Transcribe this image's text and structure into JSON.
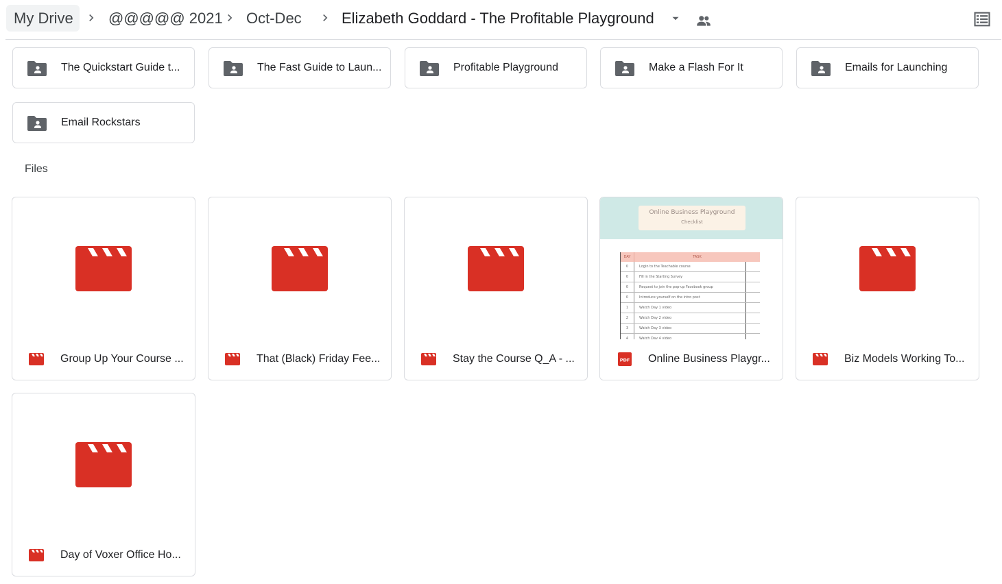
{
  "breadcrumb": {
    "items": [
      "My Drive",
      "@@@@@ 2021",
      "Oct-Dec",
      "Elizabeth Goddard - The Profitable Playground"
    ],
    "separator_icon": "chevron-right-icon",
    "dropdown_icon": "arrow-drop-down-icon",
    "shared_icon": "people-icon"
  },
  "toolbar": {
    "view_icon": "list-view-icon"
  },
  "folders": [
    {
      "label": "The Quickstart Guide t..."
    },
    {
      "label": "The Fast Guide to Laun..."
    },
    {
      "label": "Profitable Playground"
    },
    {
      "label": "Make a Flash For It"
    },
    {
      "label": "Emails for Launching"
    },
    {
      "label": "Email Rockstars"
    }
  ],
  "files_section": {
    "label": "Files"
  },
  "files": [
    {
      "name": "Group Up Your Course ...",
      "type": "video"
    },
    {
      "name": "That (Black) Friday Fee...",
      "type": "video"
    },
    {
      "name": "Stay the Course Q_A - ...",
      "type": "video"
    },
    {
      "name": "Online Business Playgr...",
      "type": "pdf"
    },
    {
      "name": "Biz Models Working To...",
      "type": "video"
    },
    {
      "name": "Day of Voxer Office Ho...",
      "type": "video"
    }
  ],
  "pdf_thumbnail": {
    "title": "Online Business Playground",
    "subtitle": "Checklist",
    "col_day": "DAY",
    "col_task": "TASK",
    "rows": [
      {
        "day": "0",
        "task": "Login to the Teachable course"
      },
      {
        "day": "0",
        "task": "Fill in the Starting Survey"
      },
      {
        "day": "0",
        "task": "Request to join the pop-up Facebook group"
      },
      {
        "day": "0",
        "task": "Introduce yourself on the intro post"
      },
      {
        "day": "1",
        "task": "Watch Day 1 video"
      },
      {
        "day": "2",
        "task": "Watch Day 2 video"
      },
      {
        "day": "3",
        "task": "Watch Day 3 video"
      },
      {
        "day": "4",
        "task": "Watch Day 4 video"
      }
    ]
  },
  "pdf_badge": "PDF",
  "colors": {
    "video_red": "#d93025",
    "folder_gray": "#5f6368",
    "border": "#dadce0",
    "crumb_bg": "#f1f3f4"
  }
}
